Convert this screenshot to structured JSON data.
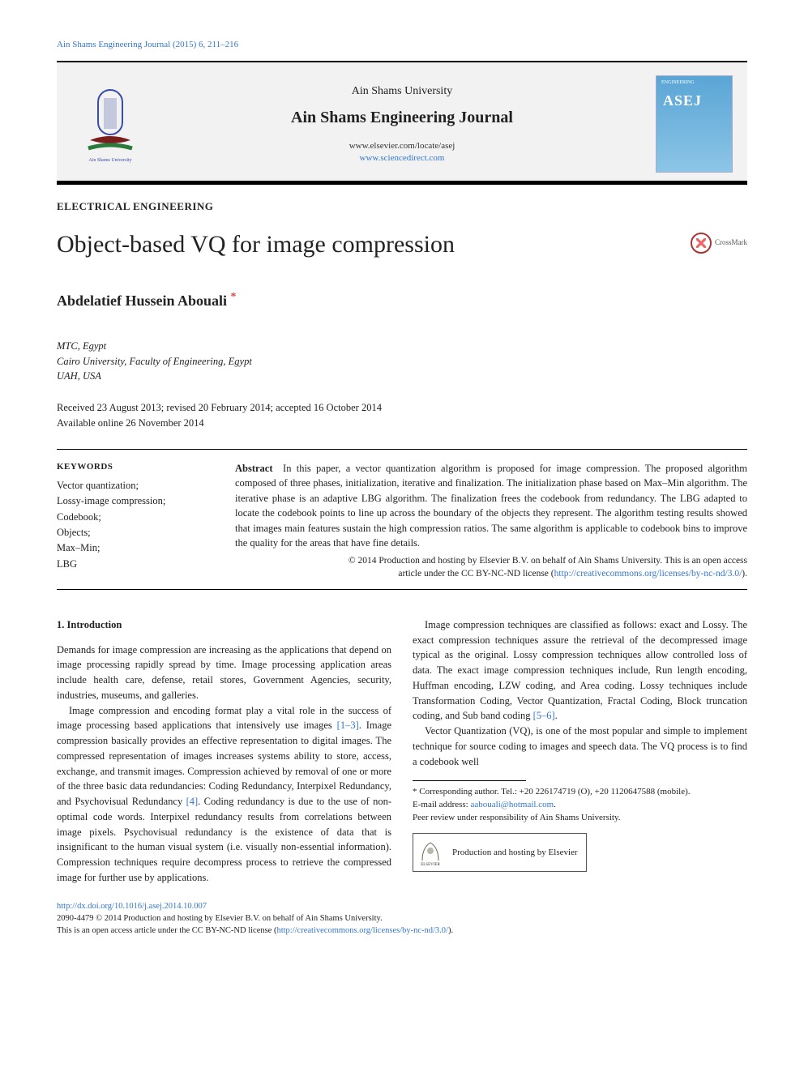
{
  "running_header": "Ain Shams Engineering Journal (2015) 6, 211–216",
  "masthead": {
    "university": "Ain Shams University",
    "journal": "Ain Shams Engineering Journal",
    "link1": "www.elsevier.com/locate/asej",
    "link2": "www.sciencedirect.com",
    "cover_top": "ENGINEERING",
    "cover_label": "ASEJ"
  },
  "section": "ELECTRICAL ENGINEERING",
  "title": "Object-based VQ for image compression",
  "crossmark": "CrossMark",
  "author": "Abdelatief Hussein Abouali",
  "affiliations": [
    "MTC, Egypt",
    "Cairo University, Faculty of Engineering, Egypt",
    "UAH, USA"
  ],
  "dates": {
    "line1": "Received 23 August 2013; revised 20 February 2014; accepted 16 October 2014",
    "line2": "Available online 26 November 2014"
  },
  "keywords_heading": "KEYWORDS",
  "keywords": [
    "Vector quantization;",
    "Lossy-image compression;",
    "Codebook;",
    "Objects;",
    "Max–Min;",
    "LBG"
  ],
  "abstract_label": "Abstract",
  "abstract_text": "In this paper, a vector quantization algorithm is proposed for image compression. The proposed algorithm composed of three phases, initialization, iterative and finalization. The initialization phase based on Max–Min algorithm. The iterative phase is an adaptive LBG algorithm. The finalization frees the codebook from redundancy. The LBG adapted to locate the codebook points to line up across the boundary of the objects they represent. The algorithm testing results showed that images main features sustain the high compression ratios. The same algorithm is applicable to codebook bins to improve the quality for the areas that have fine details.",
  "abstract_copy1": "© 2014 Production and hosting by Elsevier B.V. on behalf of Ain Shams University. This is an open access",
  "abstract_copy2_pre": "article under the CC BY-NC-ND license (",
  "abstract_copy2_link": "http://creativecommons.org/licenses/by-nc-nd/3.0/",
  "abstract_copy2_post": ").",
  "intro_heading": "1. Introduction",
  "para1": "Demands for image compression are increasing as the applications that depend on image processing rapidly spread by time. Image processing application areas include health care, defense, retail stores, Government Agencies, security, industries, museums, and galleries.",
  "para2_a": "Image compression and encoding format play a vital role in the success of image processing based applications that intensively use images ",
  "ref1": "[1–3]",
  "para2_b": ". Image compression basically provides an effective representation to digital images. The compressed representation of images increases systems ability to store, access, exchange, and transmit images. Compression achieved ",
  "para3_a": "by removal of one or more of the three basic data redundancies: Coding Redundancy, Interpixel Redundancy, and Psychovisual Redundancy ",
  "ref2": "[4]",
  "para3_b": ". Coding redundancy is due to the use of non-optimal code words. Interpixel redundancy results from correlations between image pixels. Psychovisual redundancy is the existence of data that is insignificant to the human visual system (i.e. visually non-essential information). Compression techniques require decompress process to retrieve the compressed image for further use by applications.",
  "para4_a": "Image compression techniques are classified as follows: exact and Lossy. The exact compression techniques assure the retrieval of the decompressed image typical as the original. Lossy compression techniques allow controlled loss of data. The exact image compression techniques include, Run length encoding, Huffman encoding, LZW coding, and Area coding. Lossy techniques include Transformation Coding, Vector Quantization, Fractal Coding, Block truncation coding, and Sub band coding ",
  "ref3": "[5–6]",
  "para4_b": ".",
  "para5": "Vector Quantization (VQ), is one of the most popular and simple to implement technique for source coding to images and speech data. The VQ process is to find a codebook well",
  "footnotes": {
    "corr": "* Corresponding author. Tel.: +20 226174719 (O), +20 1120647588 (mobile).",
    "email_label": "E-mail address: ",
    "email": "aabouali@hotmail.com",
    "email_post": ".",
    "peer": "Peer review under responsibility of Ain Shams University."
  },
  "hosting": "Production and hosting by Elsevier",
  "elsevier_label": "ELSEVIER",
  "bottom": {
    "doi": "http://dx.doi.org/10.1016/j.asej.2014.10.007",
    "line2": "2090-4479 © 2014 Production and hosting by Elsevier B.V. on behalf of Ain Shams University.",
    "line3_pre": "This is an open access article under the CC BY-NC-ND license (",
    "line3_link": "http://creativecommons.org/licenses/by-nc-nd/3.0/",
    "line3_post": ")."
  }
}
